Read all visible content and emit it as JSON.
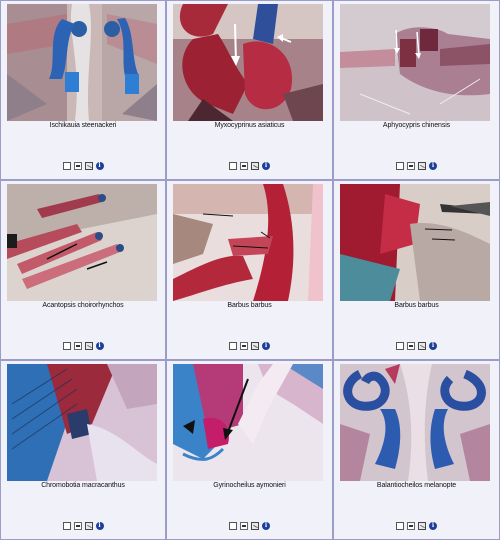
{
  "gallery": {
    "items": [
      {
        "caption": "Ischikauia steenackeri"
      },
      {
        "caption": "Myxocyprinus asiaticus"
      },
      {
        "caption": "Aphyocypris chinensis"
      },
      {
        "caption": "Acantopsis choirorhynchos"
      },
      {
        "caption": "Barbus barbus"
      },
      {
        "caption": "Barbus barbus"
      },
      {
        "caption": "Chromobotia macracanthus"
      },
      {
        "caption": "Gyrinocheilus aymonieri"
      },
      {
        "caption": "Balantiocheilos melanopte"
      }
    ],
    "tools": {
      "info_glyph": "i"
    }
  }
}
